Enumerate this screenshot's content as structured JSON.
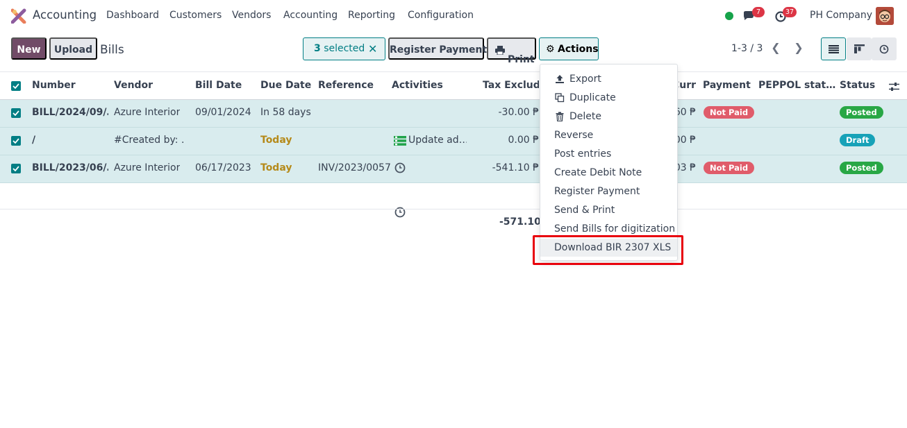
{
  "topbar": {
    "app_name": "Accounting",
    "menu": [
      "Dashboard",
      "Customers",
      "Vendors",
      "Accounting",
      "Reporting",
      "Configuration"
    ],
    "messages_count": "7",
    "activities_count": "37",
    "company": "PH Company"
  },
  "controls": {
    "new_label": "New",
    "upload_label": "Upload",
    "breadcrumb": "Bills",
    "selected_count": "3",
    "selected_text": "selected",
    "register_payment": "Register Payment",
    "print": "Print",
    "actions": "Actions",
    "pager": "1-3 / 3"
  },
  "table": {
    "headers": [
      "Number",
      "Vendor",
      "Bill Date",
      "Due Date",
      "Reference",
      "Activities",
      "Tax Excluded",
      "Total in Curr…",
      "Payment",
      "PEPPOL stat…",
      "Status"
    ],
    "rows": [
      {
        "number": "BILL/2024/09/…",
        "vendor": "Azure Interior",
        "bill_date": "09/01/2024",
        "due_date": "In 58 days",
        "reference": "",
        "activity": "",
        "tax_excluded": "-30.00 ₱",
        "total": "60 ₱",
        "payment": "Not Paid",
        "status": "Posted"
      },
      {
        "number": "/",
        "vendor": "#Created by: …",
        "bill_date": "",
        "due_date": "Today",
        "reference": "",
        "activity": "Update ad…",
        "tax_excluded": "0.00 ₱",
        "total": "00 ₱",
        "payment": "",
        "status": "Draft"
      },
      {
        "number": "BILL/2023/06/…",
        "vendor": "Azure Interior",
        "bill_date": "06/17/2023",
        "due_date": "Today",
        "reference": "INV/2023/0057",
        "activity": "",
        "tax_excluded": "-541.10 ₱",
        "total": "03 ₱",
        "payment": "Not Paid",
        "status": "Posted"
      }
    ],
    "sum_tax_excluded": "-571.10 ₱"
  },
  "dropdown": {
    "items": [
      "Export",
      "Duplicate",
      "Delete",
      "Reverse",
      "Post entries",
      "Create Debit Note",
      "Register Payment",
      "Send & Print",
      "Send Bills for digitization",
      "Download BIR 2307 XLS"
    ]
  },
  "colors": {
    "brand": "#714b67",
    "accent": "#017e84",
    "highlight_box": "#e8000b"
  }
}
